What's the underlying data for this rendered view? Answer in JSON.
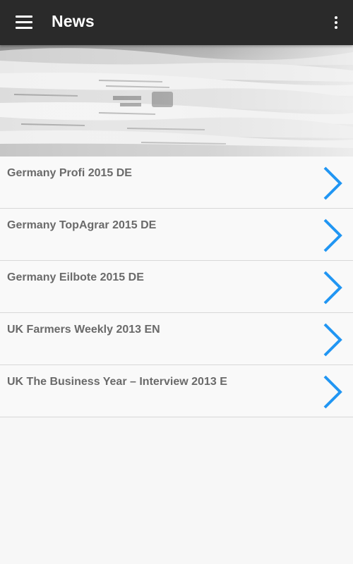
{
  "toolbar": {
    "title": "News",
    "menu_icon": "hamburger-menu-icon",
    "overflow_icon": "more-vert-icon",
    "background": "#2a2a2a"
  },
  "hero": {
    "image": "newspaper-stack-photo"
  },
  "list": {
    "chevron_icon": "chevron-right-icon",
    "chevron_color": "#2196f3",
    "items": [
      {
        "label": "Germany Profi 2015 DE"
      },
      {
        "label": "Germany TopAgrar 2015 DE"
      },
      {
        "label": "Germany Eilbote 2015 DE"
      },
      {
        "label": "UK Farmers Weekly 2013 EN"
      },
      {
        "label": "UK The Business Year – Interview 2013 E"
      }
    ]
  }
}
